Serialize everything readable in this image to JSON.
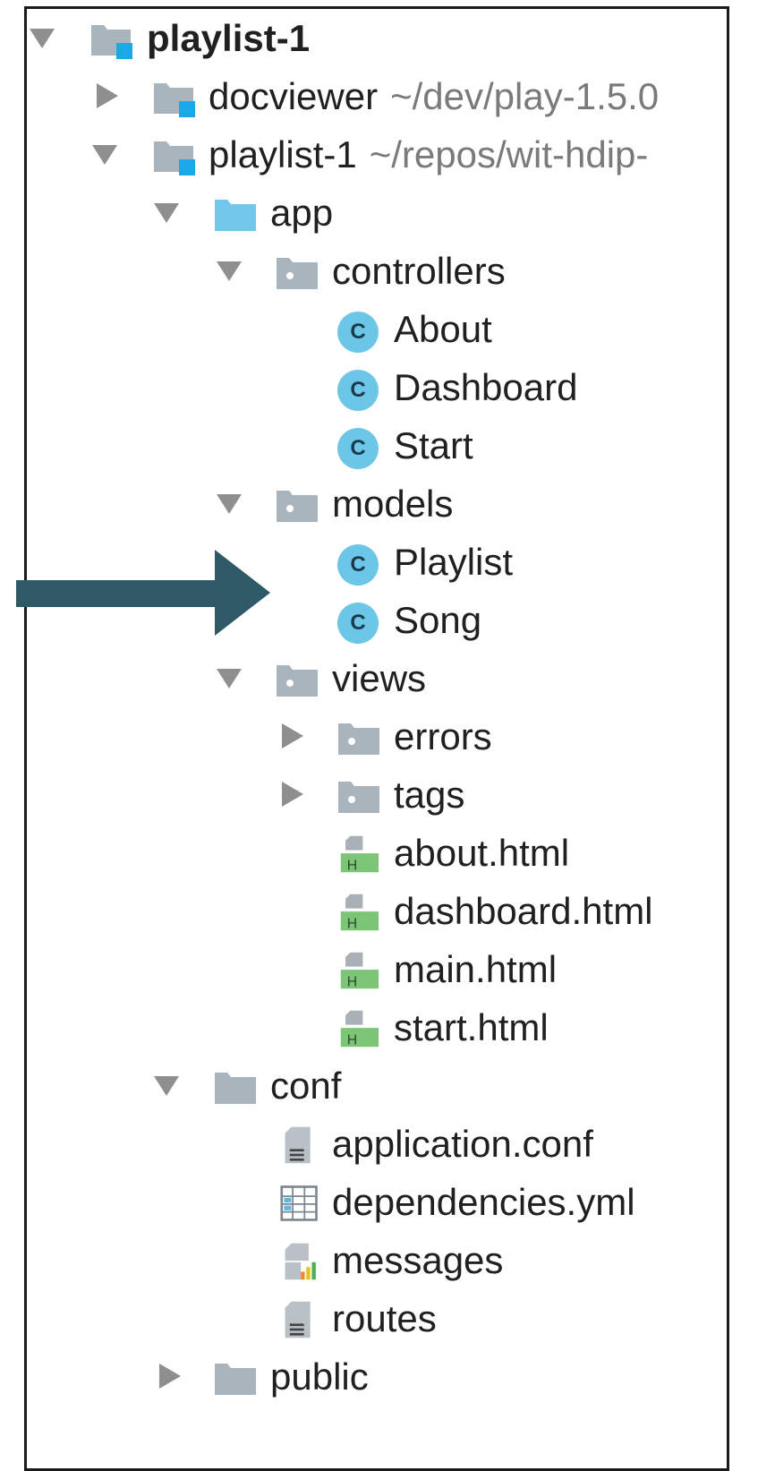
{
  "tree": {
    "root": {
      "name": "playlist-1"
    },
    "docviewer": {
      "name": "docviewer",
      "path": "~/dev/play-1.5.0"
    },
    "module": {
      "name": "playlist-1",
      "path": "~/repos/wit-hdip-"
    },
    "app": {
      "name": "app"
    },
    "controllers": {
      "name": "controllers",
      "files": [
        "About",
        "Dashboard",
        "Start"
      ]
    },
    "models": {
      "name": "models",
      "files": [
        "Playlist",
        "Song"
      ]
    },
    "views": {
      "name": "views",
      "folders": [
        "errors",
        "tags"
      ],
      "files": [
        "about.html",
        "dashboard.html",
        "main.html",
        "start.html"
      ]
    },
    "conf": {
      "name": "conf",
      "files": [
        "application.conf",
        "dependencies.yml",
        "messages",
        "routes"
      ]
    },
    "public": {
      "name": "public"
    },
    "class_badge": "C",
    "html_badge": "H"
  },
  "colors": {
    "folder": "#aab4bd",
    "source_folder": "#72c7ea",
    "module_badge": "#1aa8e6",
    "class_icon": "#6cc6e8",
    "html_badge": "#7cc576",
    "arrow": "#2e5967"
  },
  "annotation": {
    "icon": "right-arrow-icon"
  }
}
